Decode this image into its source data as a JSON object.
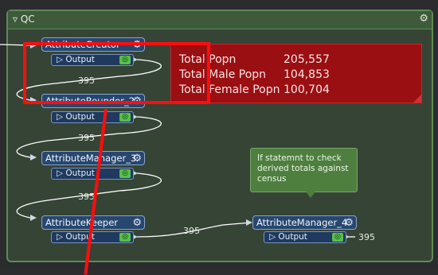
{
  "bookmark": {
    "title": "QC"
  },
  "nodes": {
    "creator": {
      "name": "AttributeCreator",
      "port": "Output"
    },
    "rounder": {
      "name": "AttributeRounder_2",
      "port": "Output"
    },
    "manager3": {
      "name": "AttributeManager_3",
      "port": "Output"
    },
    "keeper": {
      "name": "AttributeKeeper",
      "port": "Output"
    },
    "manager4": {
      "name": "AttributeManager_4",
      "port": "Output"
    }
  },
  "counts": {
    "c1": "395",
    "c2": "395",
    "c3": "395",
    "c4": "395",
    "c5": "395"
  },
  "annotation": {
    "text": "If statemnt to check derived totals against census"
  },
  "totals": {
    "rows": [
      {
        "label": "Total Popn",
        "value": "205,557"
      },
      {
        "label": "Total Male Popn",
        "value": "104,853"
      },
      {
        "label": "Total Female Popn",
        "value": "100,704"
      }
    ]
  },
  "colors": {
    "highlight": "#ff0d0d",
    "panel": "#9a0f12",
    "bookmark_border": "#5f8a56"
  }
}
